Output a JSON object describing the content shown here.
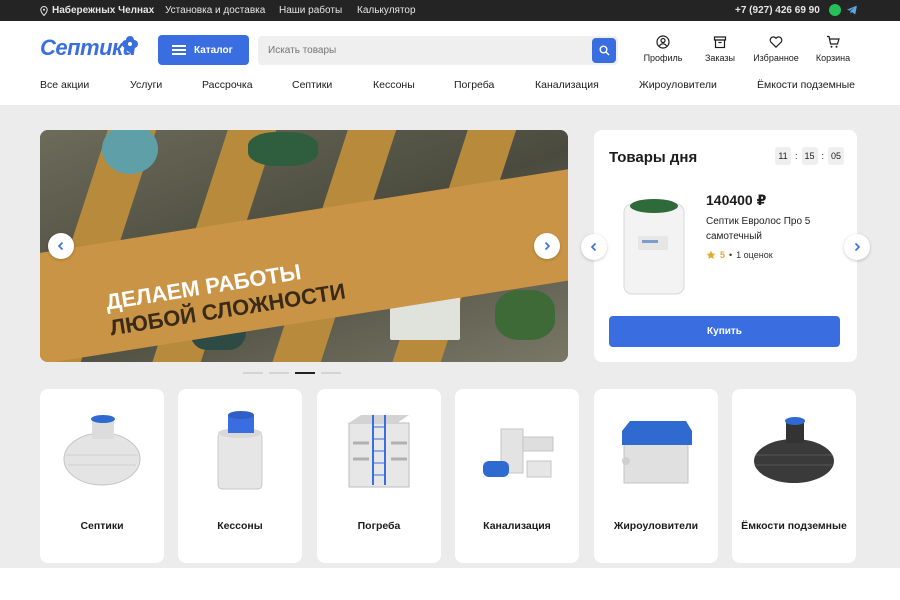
{
  "topbar": {
    "city": "Набережных Челнах",
    "links": [
      "Установка и доставка",
      "Наши работы",
      "Калькулятор"
    ],
    "phone": "+7 (927) 426 69 90",
    "messengers": [
      "whatsapp-icon",
      "telegram-icon"
    ]
  },
  "header": {
    "logo_text": "Септики",
    "catalog_label": "Каталог",
    "search_placeholder": "Искать товары",
    "icons": [
      {
        "label": "Профиль",
        "icon": "profile-icon"
      },
      {
        "label": "Заказы",
        "icon": "orders-icon"
      },
      {
        "label": "Избранное",
        "icon": "heart-icon"
      },
      {
        "label": "Корзина",
        "icon": "cart-icon"
      }
    ]
  },
  "nav": [
    "Все акции",
    "Услуги",
    "Рассрочка",
    "Септики",
    "Кессоны",
    "Погреба",
    "Канализация",
    "Жироуловители",
    "Ёмкости подземные"
  ],
  "banner": {
    "line1": "Делаем работы",
    "line2": "любой сложности",
    "slides": 4,
    "active_slide": 3
  },
  "deal": {
    "title": "Товары дня",
    "timer": [
      "11",
      "15",
      "05"
    ],
    "price": "140400 ₽",
    "product_name": "Септик Евролос Про 5 самотечный",
    "rating": "5",
    "reviews": "1 оценок",
    "buy_label": "Купить"
  },
  "categories": [
    "Септики",
    "Кессоны",
    "Погреба",
    "Канализация",
    "Жироуловители",
    "Ёмкости подземные"
  ],
  "colors": {
    "accent": "#3a6ee0",
    "topbar": "#242424",
    "banner_gold": "#c99445",
    "star": "#e2a82c"
  }
}
